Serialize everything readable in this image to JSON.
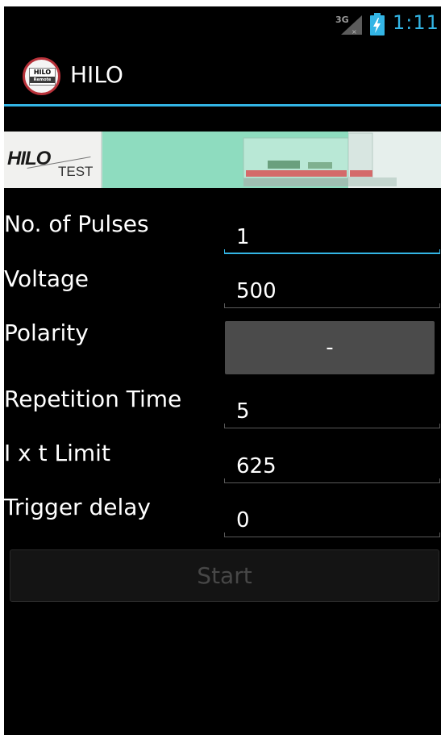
{
  "status_bar": {
    "network": "3G",
    "time": "1:11",
    "icons": [
      "signal-icon",
      "battery-charging-icon"
    ]
  },
  "action_bar": {
    "icon_text_top": "HILO",
    "icon_text_bottom": "Remote",
    "title": "HILO"
  },
  "banner": {
    "logo_main": "HILO",
    "logo_sub": "TEST"
  },
  "form": {
    "pulses_label": "No. of Pulses",
    "pulses_value": "1",
    "voltage_label": "Voltage",
    "voltage_value": "500",
    "polarity_label": "Polarity",
    "polarity_value": "-",
    "repetition_label": "Repetition Time",
    "repetition_value": "5",
    "ixt_label": "I x t Limit",
    "ixt_value": "625",
    "trigger_label": "Trigger delay",
    "trigger_value": "0"
  },
  "start_button": {
    "label": "Start",
    "enabled": false
  },
  "colors": {
    "accent": "#33b5e5",
    "background": "#000000",
    "button": "#4b4b4b",
    "disabled_text": "#474747"
  }
}
